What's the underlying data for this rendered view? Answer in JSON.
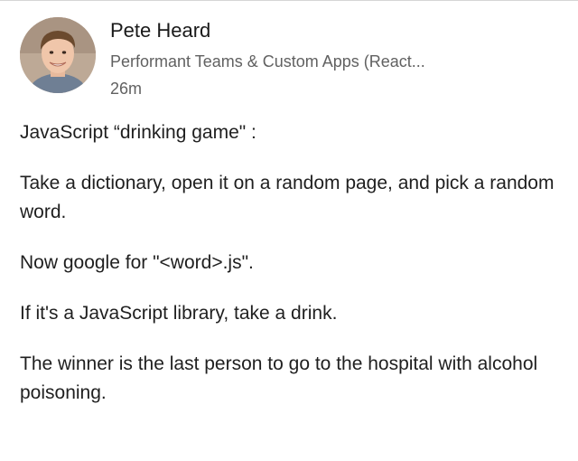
{
  "post": {
    "author": "Pete Heard",
    "subtitle": "Performant Teams & Custom Apps (React...",
    "timestamp": "26m",
    "avatar_icon": "profile-photo",
    "paragraphs": [
      "JavaScript “drinking game\" :",
      "Take a dictionary, open it on a random page, and pick a random word.",
      "Now google for \"<word>.js\".",
      "If it's a JavaScript library, take a drink.",
      "The winner is the last person to go to the hospital with alcohol poisoning."
    ]
  }
}
